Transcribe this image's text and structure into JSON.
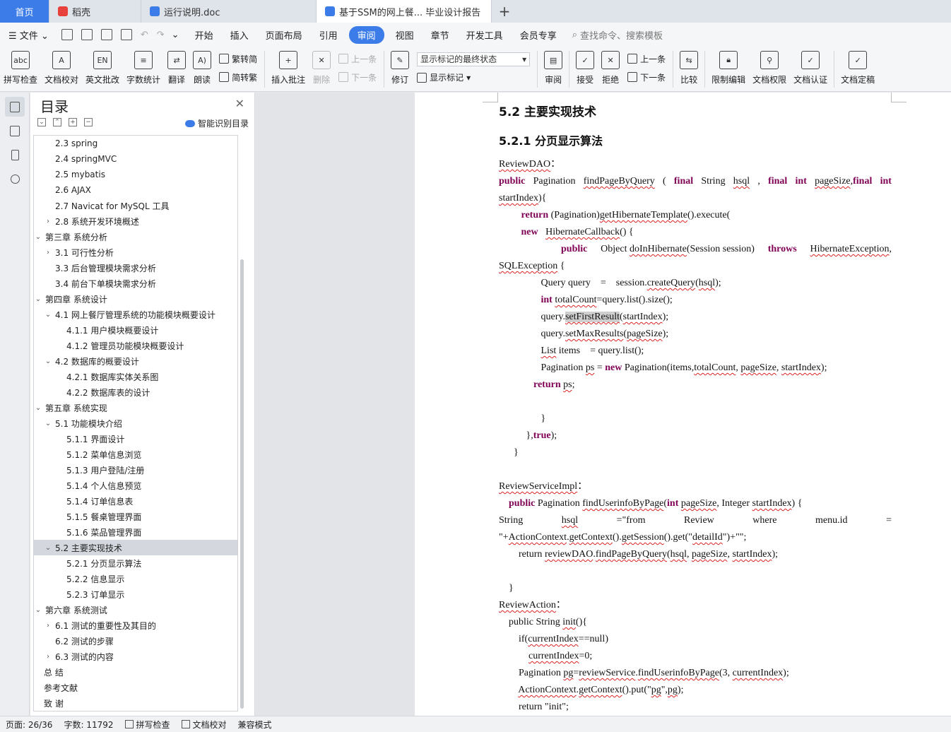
{
  "tabs": [
    {
      "label": "首页",
      "icon": "home-tab"
    },
    {
      "label": "稻壳",
      "icon": "docer-icon"
    },
    {
      "label": "运行说明.doc",
      "icon": "word-doc-icon"
    },
    {
      "label": "基于SSM的网上餐... 毕业设计报告",
      "icon": "word-doc-icon"
    }
  ],
  "menu": {
    "file": "文件",
    "items": [
      "开始",
      "插入",
      "页面布局",
      "引用",
      "审阅",
      "视图",
      "章节",
      "开发工具",
      "会员专享"
    ],
    "active": "审阅",
    "search": "查找命令、搜索模板"
  },
  "ribbon": {
    "spellcheck": "拼写检查",
    "doccheck": "文档校对",
    "english": "英文批改",
    "wordcount": "字数统计",
    "translate": "翻译",
    "read": "朗读",
    "trad": "繁转简",
    "simp": "简转繁",
    "insert_comment": "插入批注",
    "delete": "删除",
    "prev": "上一条",
    "next": "下一条",
    "revise": "修订",
    "markup_state": "显示标记的最终状态",
    "show_markup": "显示标记",
    "review": "审阅",
    "accept": "接受",
    "reject": "拒绝",
    "prev2": "上一条",
    "next2": "下一条",
    "compare": "比较",
    "restrict": "限制编辑",
    "perm": "文档权限",
    "cert": "文档认证",
    "final": "文档定稿"
  },
  "nav": {
    "title": "目录",
    "smart": "智能识别目录",
    "items": [
      {
        "label": "2.3 spring",
        "level": 2,
        "car": ""
      },
      {
        "label": "2.4 springMVC",
        "level": 2,
        "car": ""
      },
      {
        "label": "2.5 mybatis",
        "level": 2,
        "car": ""
      },
      {
        "label": "2.6 AJAX",
        "level": 2,
        "car": ""
      },
      {
        "label": "2.7 Navicat for MySQL 工具",
        "level": 2,
        "car": ""
      },
      {
        "label": "2.8 系统开发环境概述",
        "level": 2,
        "car": "›"
      },
      {
        "label": "第三章  系统分析",
        "level": 1,
        "car": "⌄"
      },
      {
        "label": "3.1 可行性分析",
        "level": 2,
        "car": "›"
      },
      {
        "label": "3.3 后台管理模块需求分析",
        "level": 2,
        "car": ""
      },
      {
        "label": "3.4 前台下单模块需求分析",
        "level": 2,
        "car": ""
      },
      {
        "label": "第四章  系统设计",
        "level": 1,
        "car": "⌄"
      },
      {
        "label": "4.1 网上餐厅管理系统的功能模块概要设计",
        "level": 2,
        "car": "⌄"
      },
      {
        "label": "4.1.1 用户模块概要设计",
        "level": 3,
        "car": ""
      },
      {
        "label": "4.1.2 管理员功能模块概要设计",
        "level": 3,
        "car": ""
      },
      {
        "label": "4.2 数据库的概要设计",
        "level": 2,
        "car": "⌄"
      },
      {
        "label": "4.2.1 数据库实体关系图",
        "level": 3,
        "car": ""
      },
      {
        "label": "4.2.2 数据库表的设计",
        "level": 3,
        "car": ""
      },
      {
        "label": "第五章  系统实现",
        "level": 1,
        "car": "⌄"
      },
      {
        "label": "5.1 功能模块介绍",
        "level": 2,
        "car": "⌄"
      },
      {
        "label": "5.1.1 界面设计",
        "level": 3,
        "car": ""
      },
      {
        "label": "5.1.2  菜单信息浏览",
        "level": 3,
        "car": ""
      },
      {
        "label": "5.1.3  用户登陆/注册",
        "level": 3,
        "car": ""
      },
      {
        "label": "5.1.4  个人信息预览",
        "level": 3,
        "car": ""
      },
      {
        "label": "5.1.4  订单信息表",
        "level": 3,
        "car": ""
      },
      {
        "label": "5.1.5  餐桌管理界面",
        "level": 3,
        "car": ""
      },
      {
        "label": "5.1.6  菜品管理界面",
        "level": 3,
        "car": ""
      },
      {
        "label": "5.2 主要实现技术",
        "level": 2,
        "car": "⌄",
        "selected": true
      },
      {
        "label": "5.2.1 分页显示算法",
        "level": 3,
        "car": ""
      },
      {
        "label": "5.2.2  信息显示",
        "level": 3,
        "car": ""
      },
      {
        "label": "5.2.3  订单显示",
        "level": 3,
        "car": ""
      },
      {
        "label": "第六章  系统测试",
        "level": 1,
        "car": "⌄"
      },
      {
        "label": "6.1 测试的重要性及其目的",
        "level": 2,
        "car": "›"
      },
      {
        "label": "6.2 测试的步骤",
        "level": 2,
        "car": ""
      },
      {
        "label": "6.3 测试的内容",
        "level": 2,
        "car": "›"
      },
      {
        "label": "总  结",
        "level": 1,
        "car": ""
      },
      {
        "label": "参考文献",
        "level": 1,
        "car": ""
      },
      {
        "label": "致  谢",
        "level": 1,
        "car": ""
      }
    ]
  },
  "doc": {
    "h2": "5.2 主要实现技术",
    "h3": "5.2.1 分页显示算法"
  },
  "status": {
    "page": "页面: 26/36",
    "words": "字数: 11792",
    "spell": "拼写检查",
    "proof": "文档校对",
    "compat": "兼容模式"
  }
}
